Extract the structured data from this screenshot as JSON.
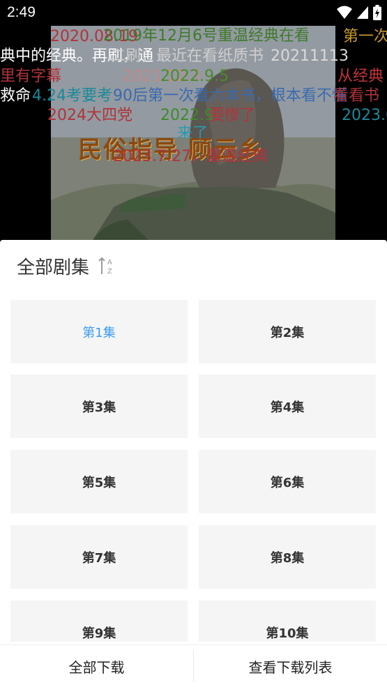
{
  "status_bar": {
    "time": "2:49",
    "icons": [
      "wifi-icon",
      "signal-icon",
      "battery-charging-icon"
    ]
  },
  "video": {
    "title_art": "民俗指导 顾云乡",
    "danmaku": [
      {
        "text": "2020.08.19",
        "color": "#b0343b"
      },
      {
        "text": "2019年12月6号重温经典在看",
        "color": "#3f7a2a"
      },
      {
        "text": "第一次",
        "color": "#c99b2a"
      },
      {
        "text": "典中的经典。再刷，通",
        "color": "#ffffff"
      },
      {
        "text": "二刷，最近在看纸质书",
        "color": "#cfcfcf"
      },
      {
        "text": "20211113",
        "color": "#d9d9d9"
      },
      {
        "text": "里有字幕",
        "color": "#b0343b"
      },
      {
        "text": "2021.12.3",
        "color": "#c28a8a"
      },
      {
        "text": "2022.9.5",
        "color": "#4b8a2a"
      },
      {
        "text": "从经典",
        "color": "#c0343b"
      },
      {
        "text": "救命",
        "color": "#ffffff"
      },
      {
        "text": "4.24考要考",
        "color": "#1a8a9a"
      },
      {
        "text": "90后第一次看六本书，根本看不懂",
        "color": "#3a6ab0"
      },
      {
        "text": "看看书",
        "color": "#b0343b"
      },
      {
        "text": "2024大四党",
        "color": "#b0343b"
      },
      {
        "text": "2022.9",
        "color": "#3f8a2a"
      },
      {
        "text": "要惨了",
        "color": "#b0343b"
      },
      {
        "text": "2023.0",
        "color": "#1a8a9a"
      },
      {
        "text": "来了",
        "color": "#2a9ab0"
      },
      {
        "text": "2023.7.27，重温经典",
        "color": "#b0343b"
      }
    ]
  },
  "panel": {
    "title": "全部剧集",
    "episodes": [
      "第1集",
      "第2集",
      "第3集",
      "第4集",
      "第5集",
      "第6集",
      "第7集",
      "第8集",
      "第9集",
      "第10集"
    ],
    "active_index": 0,
    "download_all": "全部下载",
    "view_downloads": "查看下载列表"
  },
  "colors": {
    "accent": "#3b9cf3",
    "tile_bg": "#f5f5f5"
  }
}
